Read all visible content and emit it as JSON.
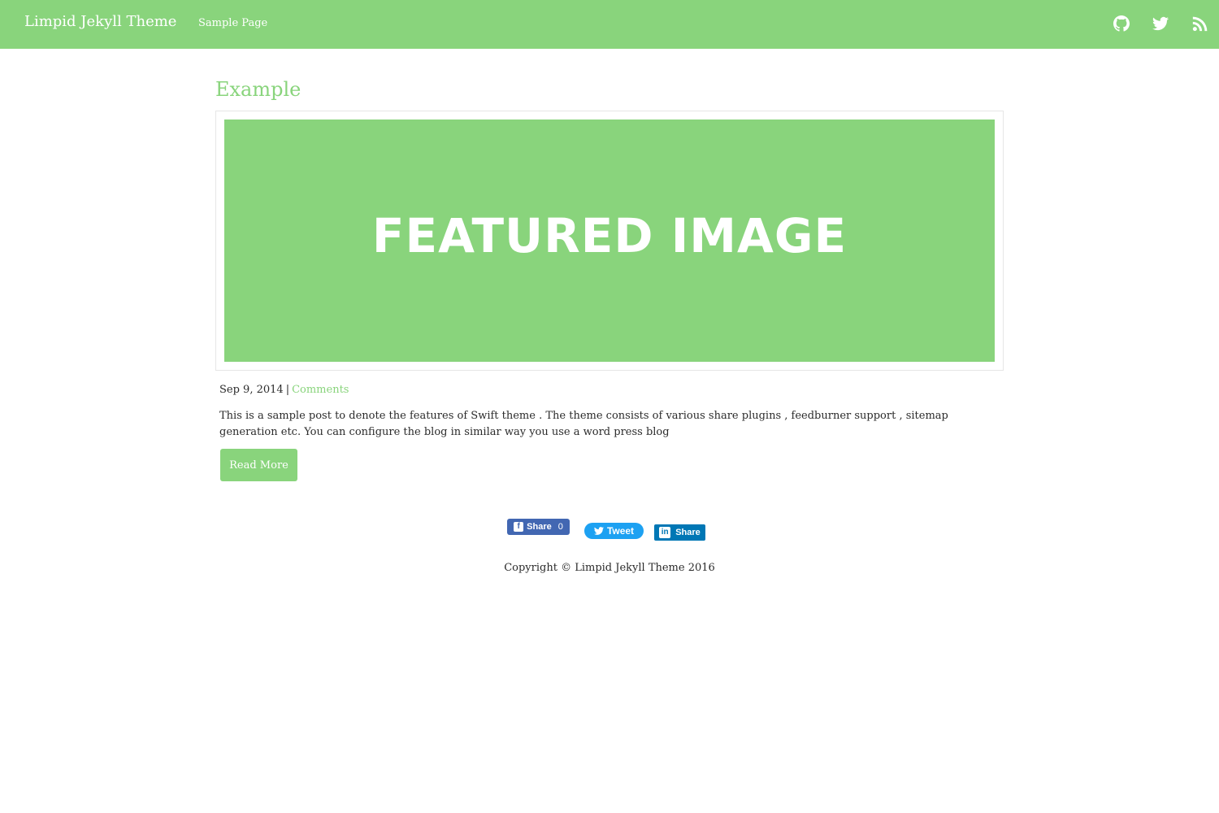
{
  "colors": {
    "accent": "#89d47c",
    "text": "#2b2b2b",
    "facebook": "#4267b2",
    "twitter": "#1da1f2",
    "linkedin": "#0077b5"
  },
  "navbar": {
    "brand": "Limpid Jekyll Theme",
    "links": [
      {
        "label": "Sample Page"
      }
    ],
    "icons": [
      "github-icon",
      "twitter-icon",
      "rss-icon"
    ]
  },
  "post": {
    "title": "Example",
    "featured_image_text": "FEATURED IMAGE",
    "date": "Sep 9, 2014",
    "separator": "|",
    "comments_label": "Comments",
    "excerpt": "This is a sample post to denote the features of Swift theme . The theme consists of various share plugins , feedburner support , sitemap generation etc. You can configure the blog in similar way you use a word press blog",
    "read_more_label": "Read More"
  },
  "share": {
    "facebook": {
      "label": "Share",
      "count": "0"
    },
    "twitter": {
      "label": "Tweet"
    },
    "linkedin": {
      "label": "Share"
    }
  },
  "footer": {
    "copyright": "Copyright © Limpid Jekyll Theme 2016"
  }
}
